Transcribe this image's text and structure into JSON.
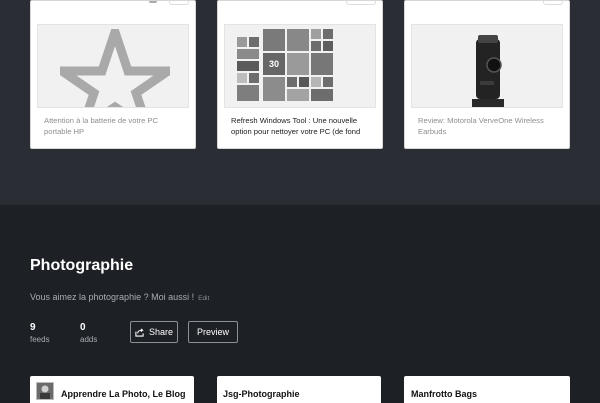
{
  "cards": [
    {
      "caption": "Attention à la batterie de votre PC portable HP",
      "thumb_icon": "star-icon"
    },
    {
      "caption": "Refresh Windows Tool : Une nouvelle option pour nettoyer votre PC (de fond",
      "tile_number": "30"
    },
    {
      "caption": "Review: Motorola VerveOne Wireless Earbuds"
    }
  ],
  "category": {
    "title": "Photographie",
    "description": "Vous aimez la photographie ? Moi aussi !",
    "edit_label": "Edit",
    "stats": [
      {
        "value": "9",
        "label": "feeds"
      },
      {
        "value": "0",
        "label": "adds"
      }
    ],
    "share_label": "Share",
    "preview_label": "Preview"
  },
  "feeds": [
    {
      "title": "Apprendre La Photo, Le Blog"
    },
    {
      "title": "Jsg-Photographie"
    },
    {
      "title": "Manfrotto Bags"
    }
  ]
}
